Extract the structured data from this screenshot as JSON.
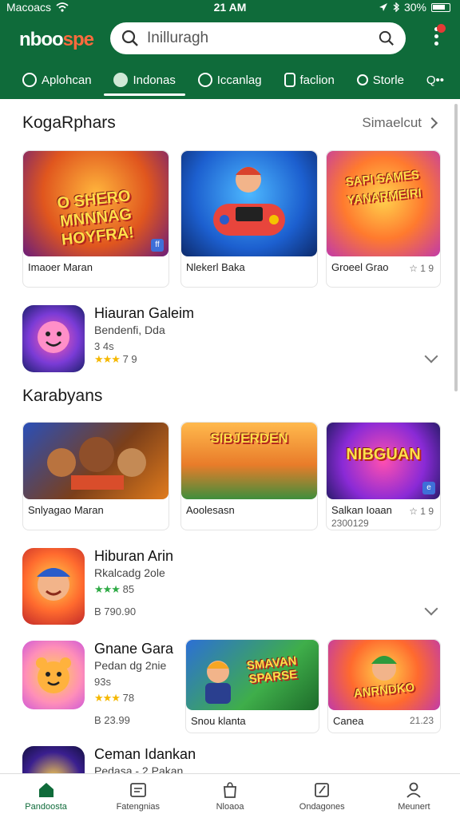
{
  "status_bar": {
    "carrier": "Macoacs",
    "time": "21 AM",
    "battery": "30%"
  },
  "header": {
    "logo_main": "nboo",
    "logo_accent": "spe",
    "search_placeholder": "Inilluragh"
  },
  "tabs": [
    {
      "label": "Aplohcan",
      "active": false
    },
    {
      "label": "Indonas",
      "active": true
    },
    {
      "label": "Iccanlag",
      "active": false
    },
    {
      "label": "faclion",
      "active": false
    },
    {
      "label": "Storle",
      "active": false
    },
    {
      "label": "Q••",
      "active": false
    }
  ],
  "section1": {
    "title": "KogaRphars",
    "see_all": "Simaelcut",
    "cards": [
      {
        "art_text": "O SHERO MNNNAG HOYFRA!",
        "caption": "Imaoer Maran",
        "rating": ""
      },
      {
        "art_text": "",
        "caption": "Nlekerl Baka",
        "rating": ""
      },
      {
        "art_text": "SAPI SAMES YANARMEIRI",
        "caption": "Groeel Grao",
        "rating": "☆ 1 9"
      }
    ]
  },
  "list1": {
    "name": "Hiauran Galeim",
    "line2": "Bendenfi, Dda",
    "line3": "3 4s",
    "stars": "★★★",
    "rating": "7 9"
  },
  "section2": {
    "title": "Karabyans",
    "cards": [
      {
        "art_text": "",
        "caption": "Snlyagao Maran",
        "sub": "",
        "rating": ""
      },
      {
        "art_text": "SIBJERDEN",
        "caption": "Aoolesasn",
        "sub": "",
        "rating": ""
      },
      {
        "art_text": "NIBGUAN",
        "caption": "Salkan Ioaan",
        "sub": "2300129",
        "rating": "☆ 1 9"
      }
    ]
  },
  "list2": {
    "name": "Hiburan Arin",
    "line2": "Rkalcadg 2ole",
    "stars": "★★★",
    "rating": "85",
    "price": "B 790.90"
  },
  "list3": {
    "name": "Gnane Gara",
    "line2": "Pedan dg 2nie",
    "line3": "93s",
    "stars": "★★★",
    "rating": "78",
    "price": "B 23.99",
    "cards": [
      {
        "art_text": "SMAVAN SPARSE",
        "caption": "Snou klanta",
        "rating": ""
      },
      {
        "art_text": "ANRNDKO",
        "caption": "Canea",
        "rating": "21.23"
      }
    ]
  },
  "list4": {
    "name": "Ceman Idankan",
    "line2": "Pedasa - 2 Pakan"
  },
  "bottom_nav": [
    {
      "label": "Pandoosta",
      "icon": "home-icon",
      "active": true
    },
    {
      "label": "Fatengnias",
      "icon": "list-icon",
      "active": false
    },
    {
      "label": "Nloaoa",
      "icon": "bag-icon",
      "active": false
    },
    {
      "label": "Ondagones",
      "icon": "edit-icon",
      "active": false
    },
    {
      "label": "Meunert",
      "icon": "person-icon",
      "active": false
    }
  ],
  "colors": {
    "header_bg": "#0f6b3a",
    "logo_accent": "#ff6a3d",
    "star_yellow": "#f5b800",
    "star_green": "#2eaa45"
  }
}
